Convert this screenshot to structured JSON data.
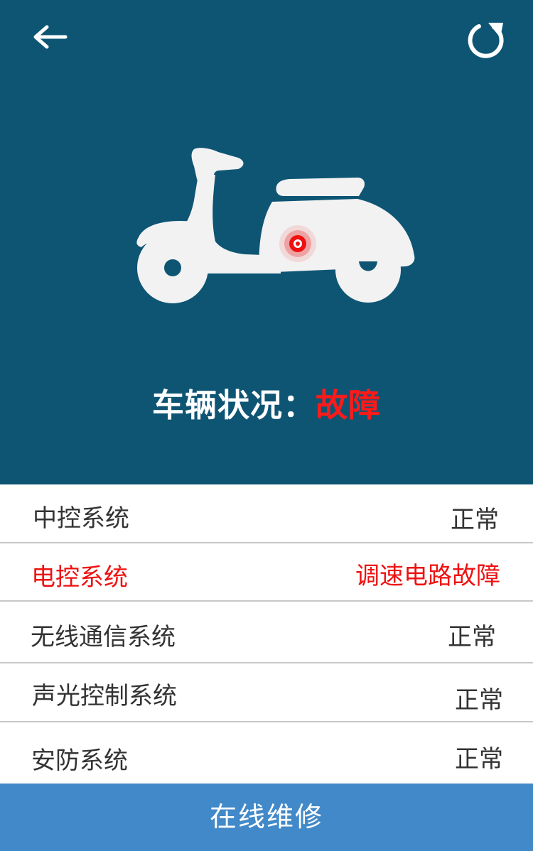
{
  "header": {
    "back_icon": "arrow-left-icon",
    "refresh_icon": "refresh-icon"
  },
  "vehicle": {
    "illustration_icon": "scooter-icon",
    "fault_marker_icon": "fault-location-icon",
    "status_label": "车辆状况：",
    "status_value": "故障",
    "status_value_color": "#ff1a1a",
    "background_color": "#0e5574"
  },
  "systems": [
    {
      "name": "中控系统",
      "status": "正常"
    },
    {
      "name": "电控系统",
      "status": "调速电路故障",
      "fault": true
    },
    {
      "name": "无线通信系统",
      "status": "正常"
    },
    {
      "name": "声光控制系统",
      "status": "正常"
    },
    {
      "name": "安防系统",
      "status": "正常"
    }
  ],
  "footer": {
    "button_label": "在线维修",
    "button_color": "#4189c8"
  }
}
